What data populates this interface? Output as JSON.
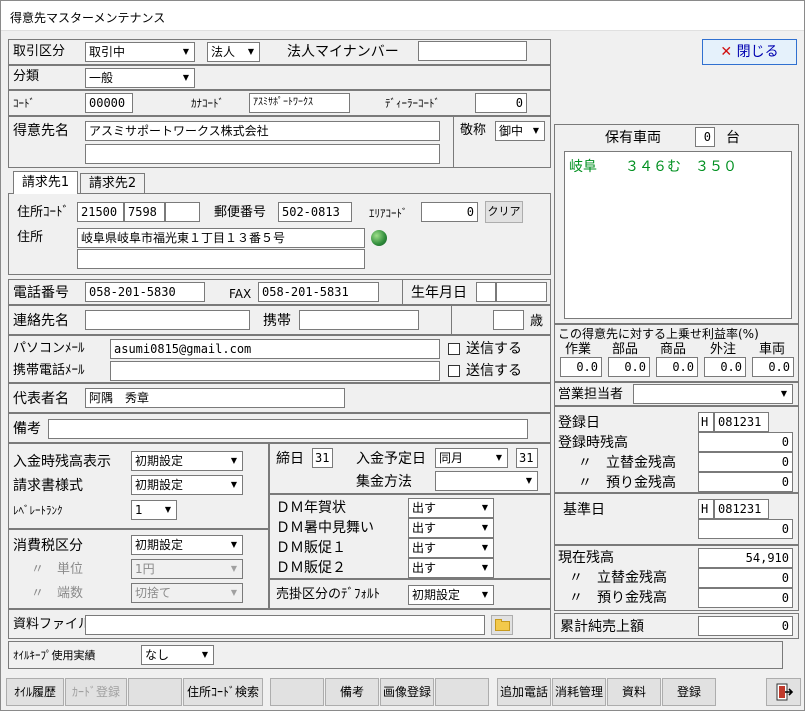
{
  "window": {
    "title": "得意先マスターメンテナンス"
  },
  "close_label": "閉じる",
  "torihiki": {
    "label": "取引区分",
    "value": "取引中",
    "type": "法人"
  },
  "mynumber": {
    "label": "法人マイナンバー",
    "value": ""
  },
  "bunrui": {
    "label": "分類",
    "value": "一般"
  },
  "code": {
    "label": "ｺｰﾄﾞ",
    "value": "00000"
  },
  "kana": {
    "label": "ｶﾅｺｰﾄﾞ",
    "value": "ｱｽﾐｻﾎﾟｰﾄﾜｰｸｽ"
  },
  "dealer": {
    "label": "ﾃﾞｨｰﾗｰｺｰﾄﾞ",
    "value": "0"
  },
  "name": {
    "label": "得意先名",
    "value": "アスミサポートワークス株式会社",
    "value2": ""
  },
  "keisho": {
    "label": "敬称",
    "value": "御中"
  },
  "tabs": [
    "請求先1",
    "請求先2"
  ],
  "address": {
    "code_label": "住所ｺｰﾄﾞ",
    "code1": "21500",
    "code2": "7598",
    "code3": "",
    "zip_label": "郵便番号",
    "zip": "502-0813",
    "area_label": "ｴﾘｱｺｰﾄﾞ",
    "area": "0",
    "clear_label": "クリア",
    "label": "住所",
    "line1": "岐阜県岐阜市福光東１丁目１３番５号",
    "line2": ""
  },
  "tel": {
    "label": "電話番号",
    "value": "058-201-5830"
  },
  "fax": {
    "label": "FAX",
    "value": "058-201-5831"
  },
  "birth": {
    "label": "生年月日",
    "value": ""
  },
  "contact": {
    "label": "連絡先名",
    "value": ""
  },
  "mobile": {
    "label": "携帯",
    "value": ""
  },
  "age": {
    "label": "歳",
    "value": ""
  },
  "pcmail": {
    "label": "パソコンﾒｰﾙ",
    "value": "asumi0815@gmail.com",
    "send": "送信する"
  },
  "mobmail": {
    "label": "携帯電話ﾒｰﾙ",
    "value": "",
    "send": "送信する"
  },
  "rep": {
    "label": "代表者名",
    "value": "阿隅　秀章"
  },
  "biko": {
    "label": "備考",
    "value": ""
  },
  "nyukin_zan": {
    "label": "入金時残高表示",
    "value": "初期設定"
  },
  "seikyu": {
    "label": "請求書様式",
    "value": "初期設定"
  },
  "level": {
    "label": "ﾚﾍﾞﾚｰﾄﾗﾝｸ",
    "value": "1"
  },
  "tax": {
    "label": "消費税区分",
    "value": "初期設定",
    "unit_label": "〃　単位",
    "unit": "1円",
    "frac_label": "〃　端数",
    "frac": "切捨て"
  },
  "shime": {
    "label": "締日",
    "value": "31"
  },
  "nyukin_date": {
    "label": "入金予定日",
    "month": "同月",
    "day": "31"
  },
  "shukin": {
    "label": "集金方法",
    "value": ""
  },
  "dm": [
    {
      "label": "ＤＭ年賀状",
      "value": "出す"
    },
    {
      "label": "ＤＭ暑中見舞い",
      "value": "出す"
    },
    {
      "label": "ＤＭ販促１",
      "value": "出す"
    },
    {
      "label": "ＤＭ販促２",
      "value": "出す"
    }
  ],
  "urikake": {
    "label": "売掛区分のﾃﾞﾌｫﾙﾄ",
    "value": "初期設定"
  },
  "shiryo": {
    "label": "資料ファイル",
    "value": ""
  },
  "oil": {
    "label": "ｵｲﾙｷｰﾌﾟ使用実績",
    "value": "なし"
  },
  "vehicles": {
    "label": "保有車両",
    "count": "0",
    "unit": "台",
    "list": [
      "岐阜　　３４６む　３５０"
    ]
  },
  "margin": {
    "title": "この得意先に対する上乗せ利益率(%)",
    "cols": [
      {
        "label": "作業",
        "value": "0.0"
      },
      {
        "label": "部品",
        "value": "0.0"
      },
      {
        "label": "商品",
        "value": "0.0"
      },
      {
        "label": "外注",
        "value": "0.0"
      },
      {
        "label": "車両",
        "value": "0.0"
      }
    ]
  },
  "sales_rep": {
    "label": "営業担当者",
    "value": ""
  },
  "reg": {
    "date_label": "登録日",
    "era": "H",
    "date": "081231",
    "zan_label": "登録時残高",
    "zan": "0",
    "tatekae_label": "〃　立替金残高",
    "tatekae": "0",
    "azukari_label": "〃　預り金残高",
    "azukari": "0"
  },
  "kijun": {
    "label": "基準日",
    "era": "H",
    "date": "081231",
    "value": "0"
  },
  "current": {
    "label": "現在残高",
    "value": "54,910",
    "tatekae_label": "〃　立替金残高",
    "tatekae": "0",
    "azukari_label": "〃　預り金残高",
    "azukari": "0"
  },
  "ruikei": {
    "label": "累計純売上額",
    "value": "0"
  },
  "bottom_buttons": [
    "ｵｲﾙ履歴",
    "ｶｰﾄﾞ登録",
    "",
    "住所ｺｰﾄﾞ検索",
    "",
    "備考",
    "画像登録",
    "",
    "追加電話",
    "消耗管理",
    "資料",
    "登録"
  ]
}
